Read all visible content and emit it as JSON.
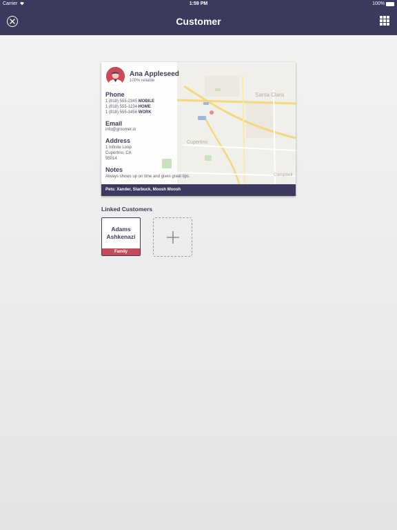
{
  "status_bar": {
    "carrier": "Carrier",
    "time": "1:59 PM",
    "battery": "100%"
  },
  "nav": {
    "title": "Customer",
    "close_icon": "close-circle-icon",
    "grid_icon": "grid-icon"
  },
  "customer": {
    "name": "Ana Appleseed",
    "reliability": "100% reliable",
    "phone_title": "Phone",
    "phones": [
      {
        "number": "1 (818) 555-2345",
        "type": "MOBILE"
      },
      {
        "number": "1 (818) 555-1234",
        "type": "HOME"
      },
      {
        "number": "1 (818) 555-3456",
        "type": "WORK"
      }
    ],
    "email_title": "Email",
    "email": "info@groomer.io",
    "address_title": "Address",
    "address_lines": [
      "1 Infinite Loop",
      "Cupertino, CA",
      "95014"
    ],
    "notes_title": "Notes",
    "notes": "Always shows up on time and gives great tips.",
    "pets": "Pets: Xander, Starbuck, Moosh Moosh"
  },
  "map_labels": {
    "santa_clara": "Santa Clara",
    "cupertino": "Cupertino",
    "campbell": "Campbell"
  },
  "linked": {
    "title": "Linked Customers",
    "customers": [
      {
        "first": "Adams",
        "last": "Ashkenazi",
        "relation": "Family"
      }
    ],
    "add_icon": "plus-icon"
  },
  "colors": {
    "primary": "#3b3a5e",
    "accent": "#c34a5a"
  }
}
